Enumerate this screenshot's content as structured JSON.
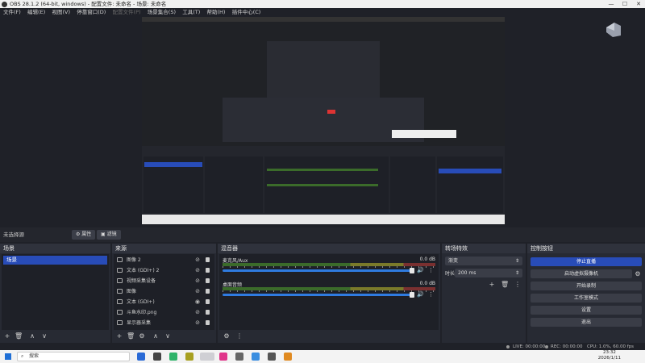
{
  "window": {
    "title": "OBS 28.1.2 (64-bit, windows) - 配置文件: 未命名 - 场景: 未命名",
    "controls": [
      "—",
      "☐",
      "✕"
    ]
  },
  "menu": {
    "items": [
      {
        "label": "文件(F)",
        "enabled": true
      },
      {
        "label": "编辑(E)",
        "enabled": true
      },
      {
        "label": "视图(V)",
        "enabled": true
      },
      {
        "label": "停靠窗口(D)",
        "enabled": true
      },
      {
        "label": "配置文件(P)",
        "enabled": false
      },
      {
        "label": "场景集合(S)",
        "enabled": true
      },
      {
        "label": "工具(T)",
        "enabled": true
      },
      {
        "label": "帮助(H)",
        "enabled": true
      },
      {
        "label": "插件中心(C)",
        "enabled": true
      }
    ]
  },
  "scenebar": {
    "no_source": "未选择源",
    "properties_label": "属性",
    "filters_label": "滤镜"
  },
  "scenes": {
    "title": "场景",
    "items": [
      "场景"
    ]
  },
  "sources": {
    "title": "来源",
    "items": [
      {
        "label": "图像 2",
        "visible": false
      },
      {
        "label": "文本 (GDI+) 2",
        "visible": false
      },
      {
        "label": "视频采集设备",
        "visible": false
      },
      {
        "label": "图像",
        "visible": false
      },
      {
        "label": "文本 (GDI+)",
        "visible": true
      },
      {
        "label": "斗鱼水印.png",
        "visible": false
      },
      {
        "label": "显示器采集",
        "visible": false
      }
    ]
  },
  "mixer": {
    "title": "混音器",
    "channels": [
      {
        "name": "麦克风/Aux",
        "db": "0.0 dB",
        "level": 1.0
      },
      {
        "name": "桌面音频",
        "db": "0.0 dB",
        "level": 1.0
      }
    ]
  },
  "transitions": {
    "title": "转场特效",
    "selected": "渐变",
    "duration_label": "时长",
    "duration_value": "200 ms"
  },
  "controls": {
    "title": "控制按钮",
    "buttons": [
      "停止直播",
      "启动虚拟摄像机",
      "开始录制",
      "工作室模式",
      "设置",
      "退出"
    ]
  },
  "status": {
    "live": "LIVE: 00:00:00",
    "rec": "REC: 00:00:00",
    "cpu": "CPU: 1.0%, 60.00 fps"
  },
  "taskbar": {
    "search_placeholder": "搜索",
    "time": "23:32",
    "date": "2026/1/11"
  },
  "colors": {
    "accent": "#284cb8",
    "panel": "#272a33",
    "fader": "#2f7be0"
  }
}
